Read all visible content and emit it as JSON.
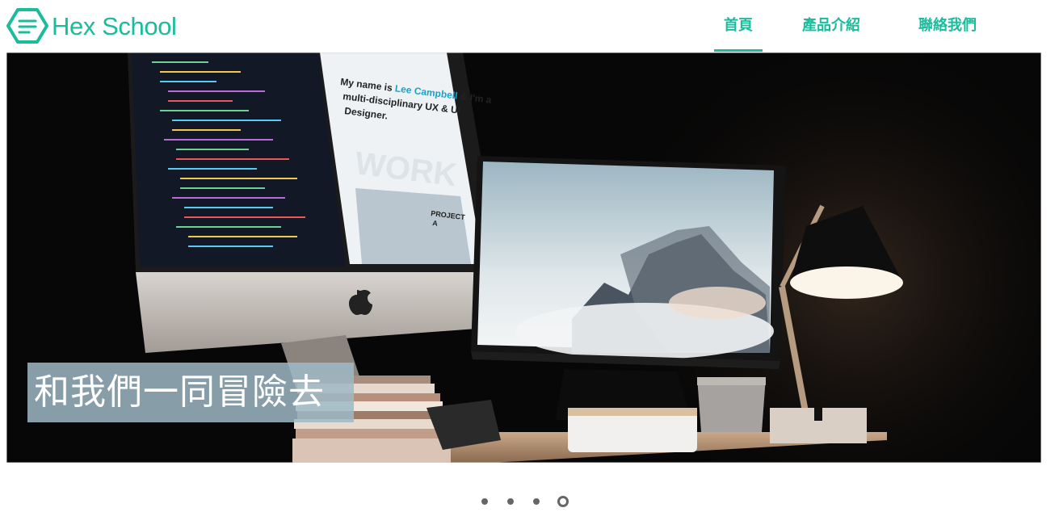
{
  "brand": {
    "name": "Hex School",
    "color": "#1abc9c"
  },
  "nav": {
    "items": [
      {
        "label": "首頁",
        "active": true
      },
      {
        "label": "產品介紹",
        "active": false
      },
      {
        "label": "聯絡我們",
        "active": false
      }
    ]
  },
  "hero": {
    "caption": "和我們一同冒險去",
    "screen_heading": "My name is Lee Campbell & I'm a multi-disciplinary UX & UI Designer.",
    "screen_watermark": "WORK",
    "screen_project": "PROJECT A"
  },
  "carousel": {
    "slide_count": 4,
    "active_index": 3
  }
}
